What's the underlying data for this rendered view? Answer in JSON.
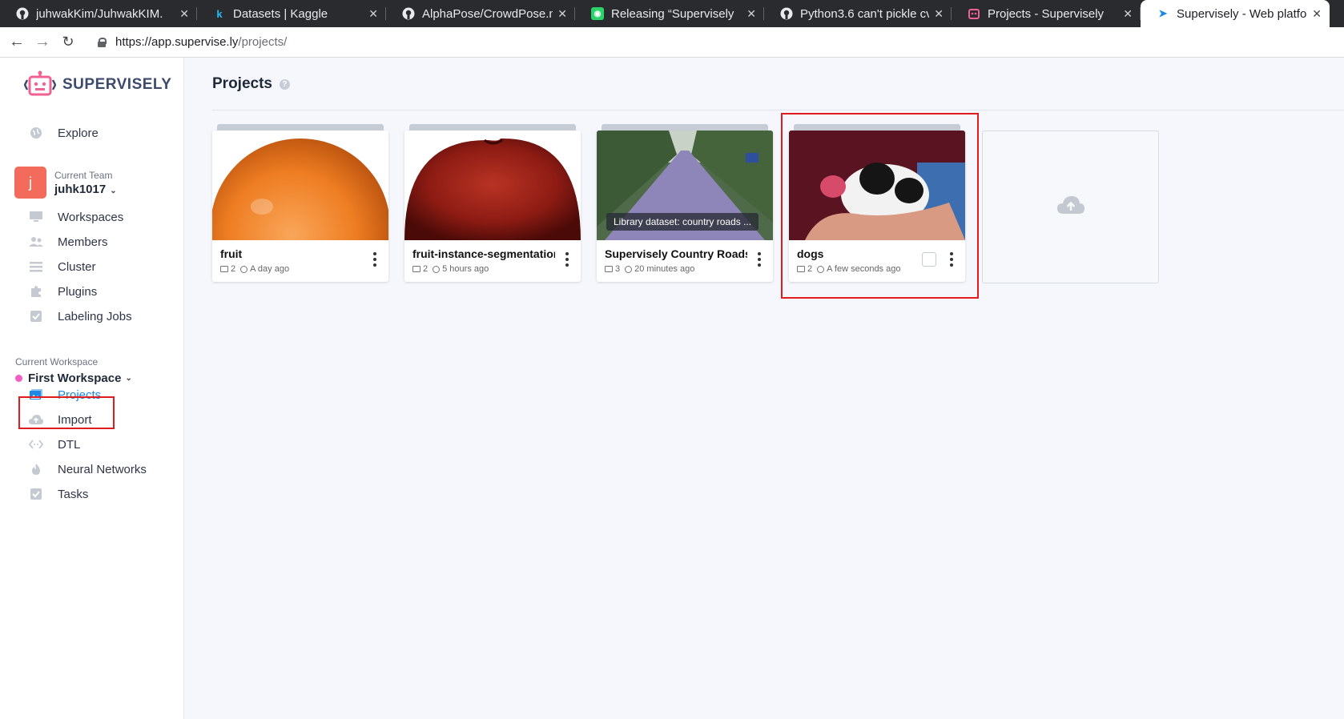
{
  "browser": {
    "tabs": [
      {
        "title": "juhwakKim/JuhwakKIM.",
        "favicon": "github-icon"
      },
      {
        "title": "Datasets | Kaggle",
        "favicon": "kaggle-icon"
      },
      {
        "title": "AlphaPose/CrowdPose.n",
        "favicon": "github-icon"
      },
      {
        "title": "Releasing “Supervisely",
        "favicon": "supervisely-icon"
      },
      {
        "title": "Python3.6 can't pickle cv",
        "favicon": "github-icon"
      },
      {
        "title": "Projects - Supervisely",
        "favicon": "supervisely-icon"
      },
      {
        "title": "Supervisely - Web platfor",
        "favicon": "pointer-icon"
      }
    ],
    "url_host": "https://app.supervise.ly",
    "url_path": "/projects/"
  },
  "sidebar": {
    "logo_text": "SUPERVISELY",
    "explore_label": "Explore",
    "team": {
      "label": "Current Team",
      "name": "juhk1017",
      "avatar_letter": "j"
    },
    "team_items": [
      {
        "label": "Workspaces",
        "icon": "monitor-icon"
      },
      {
        "label": "Members",
        "icon": "users-icon"
      },
      {
        "label": "Cluster",
        "icon": "list-icon"
      },
      {
        "label": "Plugins",
        "icon": "puzzle-icon"
      },
      {
        "label": "Labeling Jobs",
        "icon": "check-square-icon"
      }
    ],
    "workspace": {
      "label": "Current Workspace",
      "name": "First Workspace",
      "color": "#f25ec2"
    },
    "workspace_items": [
      {
        "label": "Projects",
        "icon": "images-icon",
        "active": true
      },
      {
        "label": "Import",
        "icon": "cloud-upload-icon"
      },
      {
        "label": "DTL",
        "icon": "code-icon"
      },
      {
        "label": "Neural Networks",
        "icon": "flame-icon"
      },
      {
        "label": "Tasks",
        "icon": "check-square-icon"
      }
    ]
  },
  "main": {
    "title": "Projects",
    "projects": [
      {
        "name": "fruit",
        "datasets": "2",
        "updated": "A day ago",
        "thumbnail": "orange"
      },
      {
        "name": "fruit-instance-segmentation",
        "datasets": "2",
        "updated": "5 hours ago",
        "thumbnail": "apple"
      },
      {
        "name": "Supervisely Country Roads",
        "datasets": "3",
        "updated": "20 minutes ago",
        "thumbnail": "road",
        "thumb_label": "Library dataset: country roads ..."
      },
      {
        "name": "dogs",
        "datasets": "2",
        "updated": "A few seconds ago",
        "thumbnail": "puppy",
        "highlighted": true
      }
    ]
  },
  "colors": {
    "accent": "#1e88e5",
    "highlight": "#e01c1c",
    "team_avatar": "#f26b5b"
  }
}
